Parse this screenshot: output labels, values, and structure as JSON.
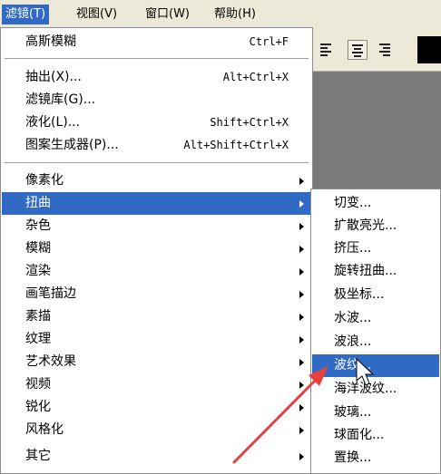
{
  "menubar": [
    {
      "label": "滤镜(T)",
      "active": true
    },
    {
      "label": "视图(V)",
      "active": false
    },
    {
      "label": "窗口(W)",
      "active": false
    },
    {
      "label": "帮助(H)",
      "active": false
    }
  ],
  "filter_menu": [
    {
      "label": "高斯模糊",
      "shortcut": "Ctrl+F"
    },
    {
      "label": "抽出(X)...",
      "shortcut": "Alt+Ctrl+X"
    },
    {
      "label": "滤镜库(G)...",
      "shortcut": ""
    },
    {
      "label": "液化(L)...",
      "shortcut": "Shift+Ctrl+X"
    },
    {
      "label": "图案生成器(P)...",
      "shortcut": "Alt+Shift+Ctrl+X"
    },
    {
      "label": "像素化"
    },
    {
      "label": "扭曲",
      "highlighted": true
    },
    {
      "label": "杂色"
    },
    {
      "label": "模糊"
    },
    {
      "label": "渲染"
    },
    {
      "label": "画笔描边"
    },
    {
      "label": "素描"
    },
    {
      "label": "纹理"
    },
    {
      "label": "艺术效果"
    },
    {
      "label": "视频"
    },
    {
      "label": "锐化"
    },
    {
      "label": "风格化"
    },
    {
      "label": "其它"
    }
  ],
  "distort_submenu": [
    {
      "label": "切变..."
    },
    {
      "label": "扩散亮光..."
    },
    {
      "label": "挤压..."
    },
    {
      "label": "旋转扭曲..."
    },
    {
      "label": "极坐标..."
    },
    {
      "label": "水波..."
    },
    {
      "label": "波浪..."
    },
    {
      "label": "波纹...",
      "highlighted": true
    },
    {
      "label": "海洋波纹..."
    },
    {
      "label": "玻璃..."
    },
    {
      "label": "球面化..."
    },
    {
      "label": "置换..."
    }
  ],
  "colors": {
    "highlight": "#316ac5",
    "arrow": "#e8403f"
  },
  "icons": [
    "align-left-icon",
    "align-center-icon",
    "align-right-icon",
    "arrow-cursor-icon",
    "submenu-arrow-icon"
  ]
}
